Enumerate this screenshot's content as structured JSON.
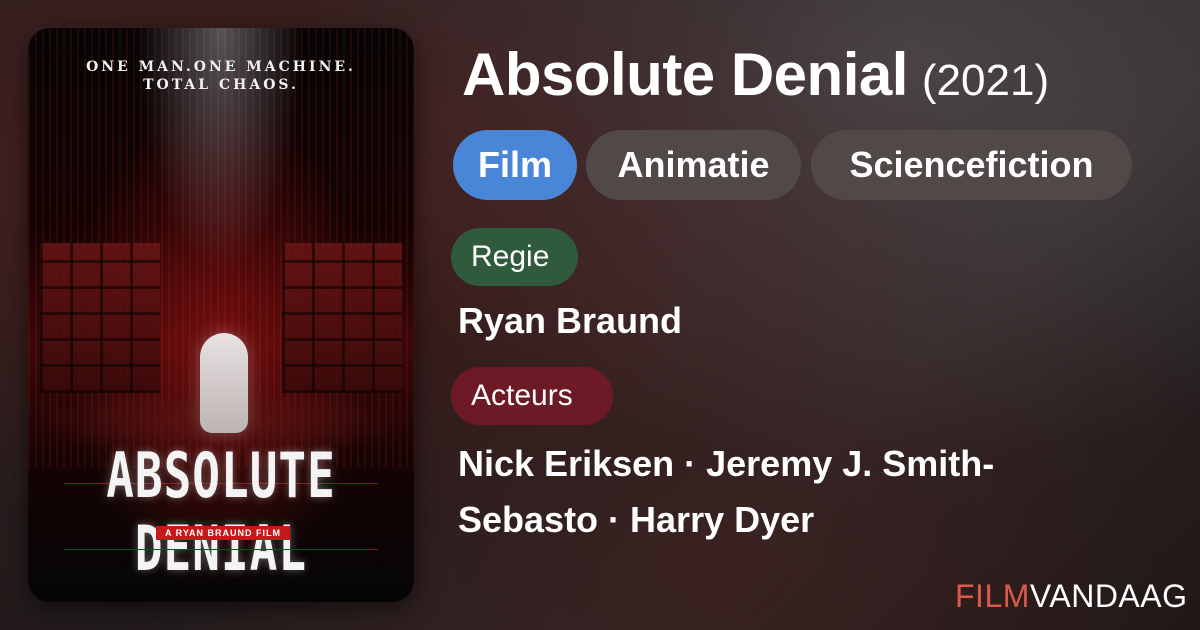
{
  "colors": {
    "film_pill": "#4a86d8",
    "genre_pill": "#514848",
    "regie_tag": "#2f5a3c",
    "acteurs_tag": "#6e1a26",
    "brand_film": "#d95a4a",
    "brand_vandaag": "#ffffff"
  },
  "poster": {
    "tagline_line1": "ONE MAN.ONE MACHINE.",
    "tagline_line2": "TOTAL CHAOS.",
    "title": "ABSOLUTE DENIAL",
    "credit": "A RYAN BRAUND FILM"
  },
  "movie": {
    "title": "Absolute Denial",
    "year": "(2021)"
  },
  "genres": [
    "Film",
    "Animatie",
    "Sciencefiction"
  ],
  "director_label": "Regie",
  "director": "Ryan Braund",
  "cast_label": "Acteurs",
  "cast": "Nick Eriksen · Jeremy J. Smith-Sebasto · Harry Dyer",
  "brand": {
    "part1": "FILM",
    "part2": "VANDAAG"
  }
}
